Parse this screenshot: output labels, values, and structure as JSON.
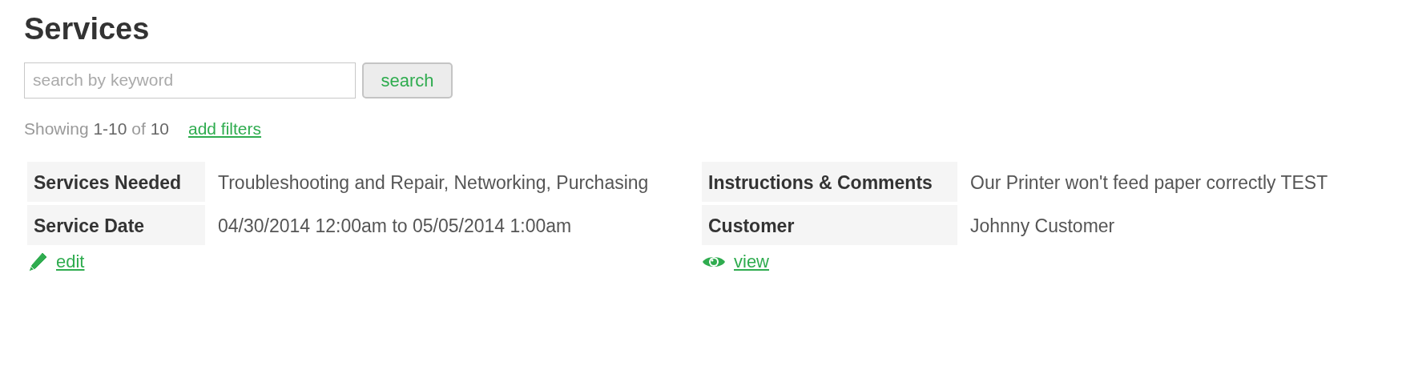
{
  "title": "Services",
  "search": {
    "placeholder": "search by keyword",
    "button": "search"
  },
  "results": {
    "showing": "Showing",
    "range": "1-10",
    "of": "of",
    "total": "10",
    "filters_link": "add filters"
  },
  "panels": [
    {
      "rows": [
        {
          "label": "Services Needed",
          "value": "Troubleshooting and Repair, Networking, Purchasing"
        },
        {
          "label": "Service Date",
          "value": "04/30/2014 12:00am to 05/05/2014 1:00am"
        }
      ],
      "action": {
        "kind": "edit",
        "label": "edit"
      }
    },
    {
      "rows": [
        {
          "label": "Instructions & Comments",
          "value": "Our Printer won't feed paper correctly TEST"
        },
        {
          "label": "Customer",
          "value": "Johnny Customer"
        }
      ],
      "action": {
        "kind": "view",
        "label": "view"
      }
    }
  ]
}
